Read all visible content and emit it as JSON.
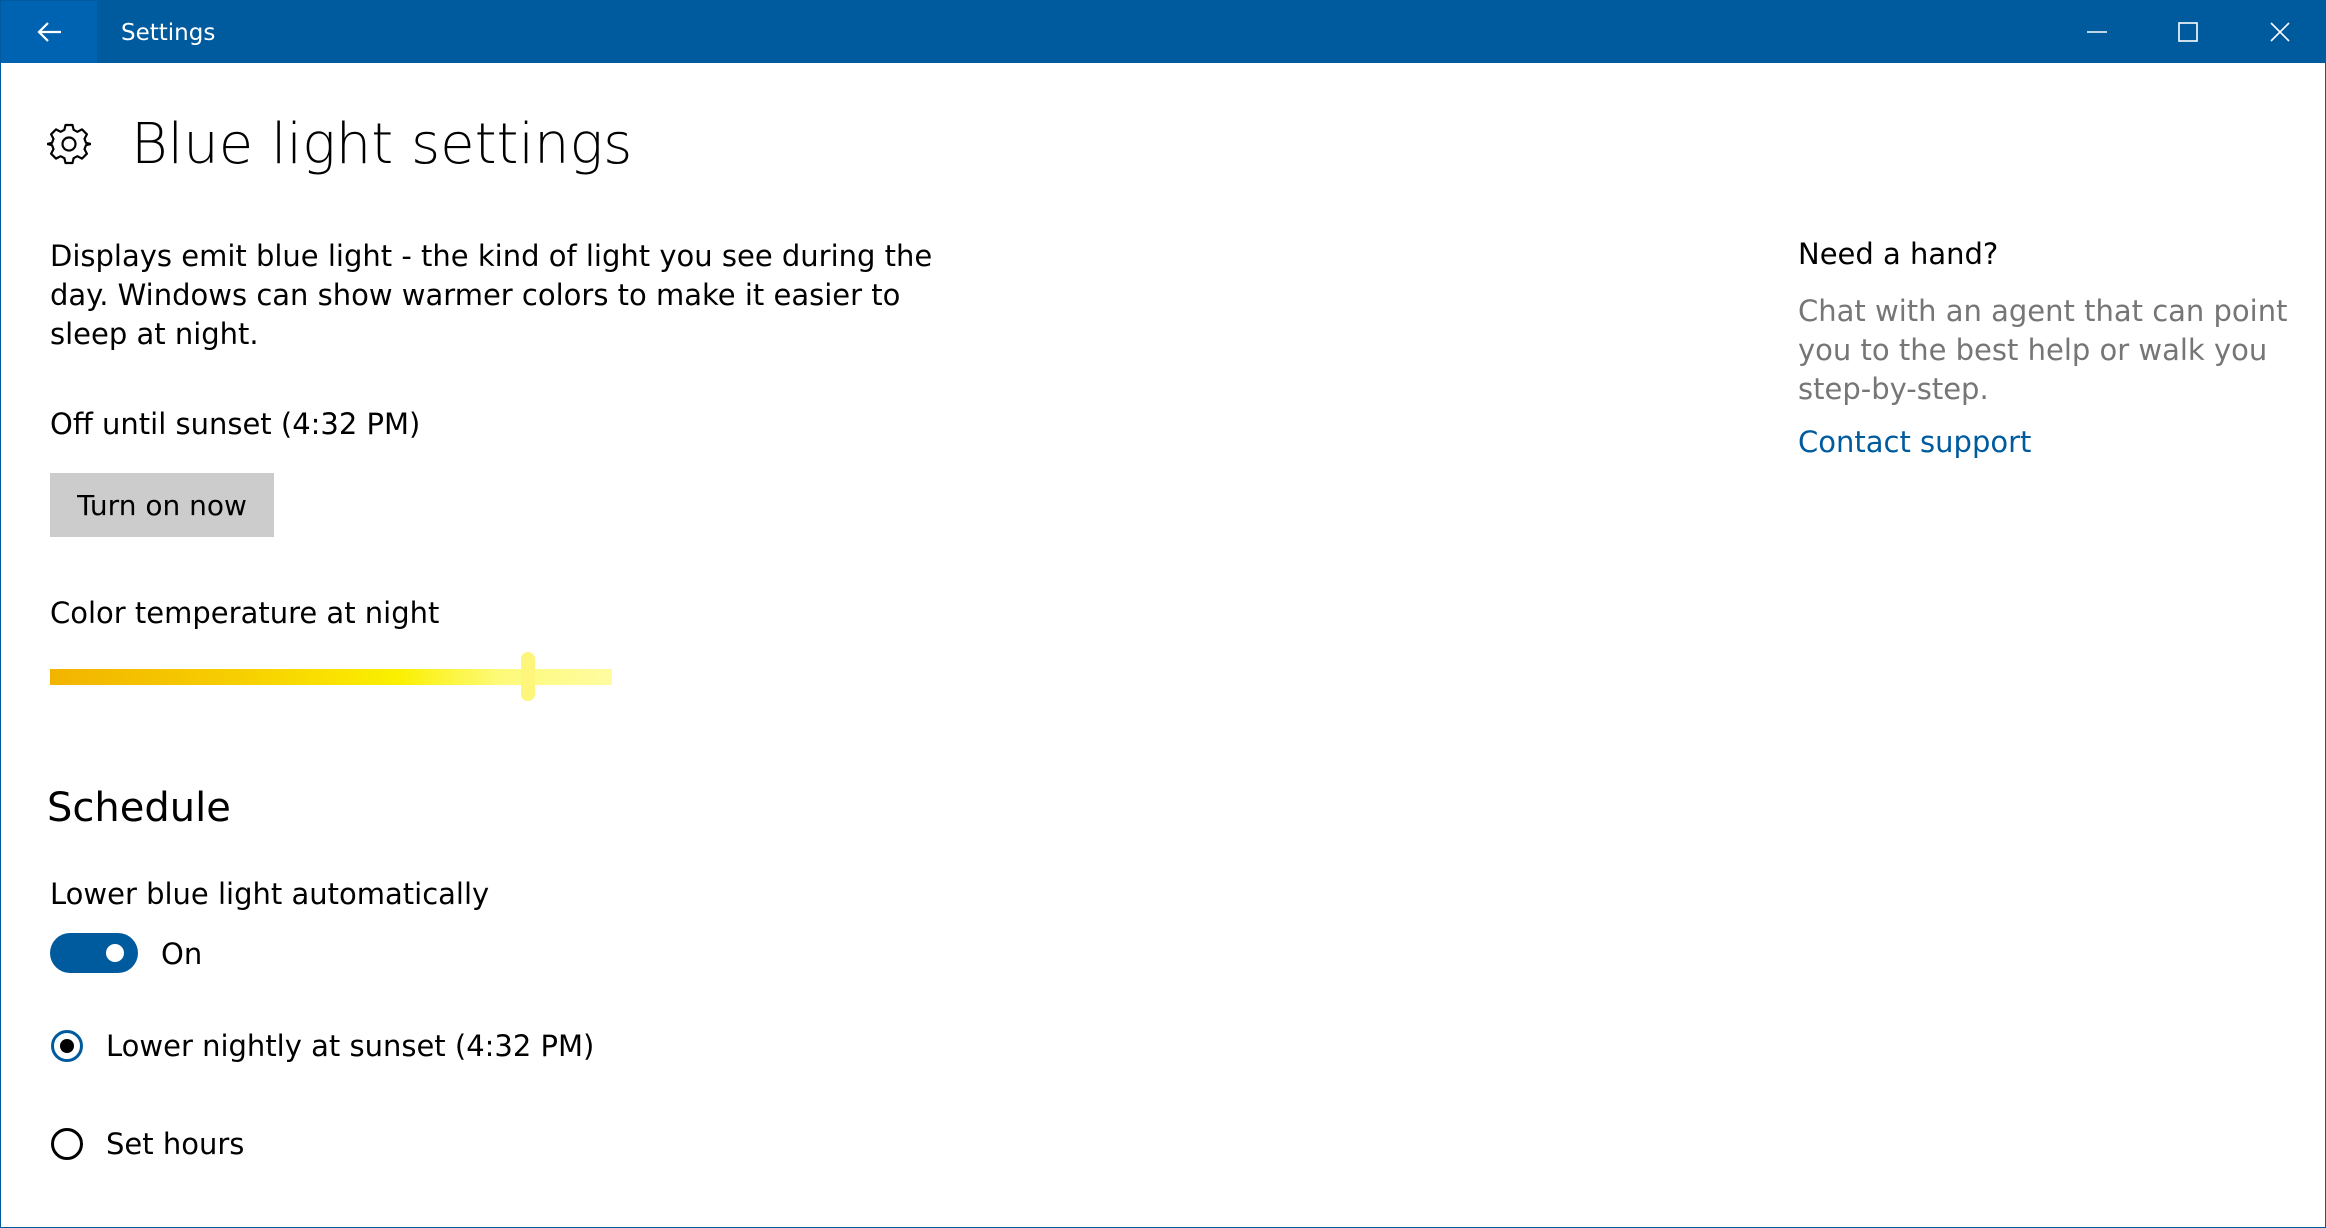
{
  "window": {
    "title": "Settings",
    "back_icon": "arrow-left-icon",
    "controls": [
      "minimize-icon",
      "maximize-icon",
      "close-icon"
    ],
    "titlebar_color": "#005a9e"
  },
  "page": {
    "icon": "gear-icon",
    "title": "Blue light settings",
    "intro": "Displays emit blue light - the kind of light you see during the day. Windows can show warmer colors to make it easier to sleep at night.",
    "status": "Off until sunset (4:32 PM)",
    "turn_on_label": "Turn on now",
    "slider_label": "Color temperature at night",
    "slider_value_fraction": 0.85
  },
  "schedule": {
    "heading": "Schedule",
    "toggle_label": "Lower blue light automatically",
    "toggle_state": "On",
    "toggle_on": true,
    "options": [
      {
        "label": "Lower nightly at sunset (4:32 PM)",
        "selected": true
      },
      {
        "label": "Set hours",
        "selected": false
      }
    ]
  },
  "help": {
    "heading": "Need a hand?",
    "body": "Chat with an agent that can point you to the best help or walk you step-by-step.",
    "link": "Contact support"
  },
  "colors": {
    "accent": "#005a9e",
    "button_bg": "#cccccc",
    "secondary_text": "#767676",
    "slider_warm": "#f2b400",
    "slider_cool": "#fefca0"
  }
}
